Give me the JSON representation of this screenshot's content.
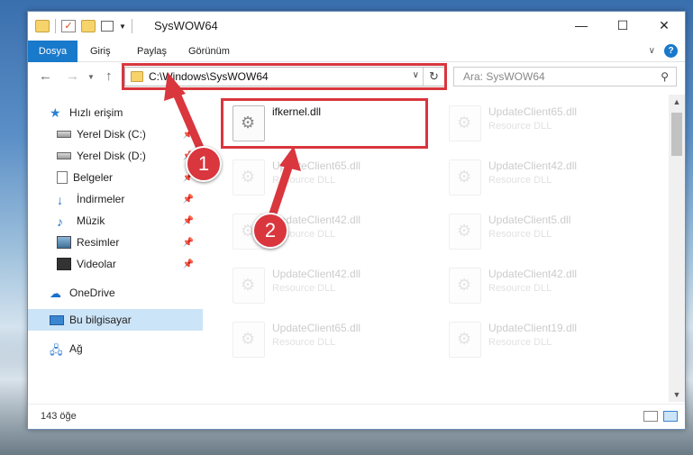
{
  "window": {
    "title": "SysWOW64"
  },
  "ribbon": {
    "tabs": [
      "Dosya",
      "Giriş",
      "Paylaş",
      "Görünüm"
    ],
    "help": "?"
  },
  "nav": {
    "address": "C:\\Windows\\SysWOW64",
    "search_placeholder": "Ara: SysWOW64"
  },
  "sidebar": {
    "items": [
      {
        "label": "Hızlı erişim",
        "icon": "quick-access-star-icon"
      },
      {
        "label": "Yerel Disk (C:)",
        "icon": "disk-icon",
        "pinned": true
      },
      {
        "label": "Yerel Disk (D:)",
        "icon": "disk-icon",
        "pinned": true
      },
      {
        "label": "Belgeler",
        "icon": "documents-icon",
        "pinned": true
      },
      {
        "label": "İndirmeler",
        "icon": "downloads-icon",
        "pinned": true
      },
      {
        "label": "Müzik",
        "icon": "music-icon",
        "pinned": true
      },
      {
        "label": "Resimler",
        "icon": "pictures-icon",
        "pinned": true
      },
      {
        "label": "Videolar",
        "icon": "videos-icon",
        "pinned": true
      },
      {
        "label": "OneDrive",
        "icon": "onedrive-icon"
      },
      {
        "label": "Bu bilgisayar",
        "icon": "this-pc-icon",
        "selected": true
      },
      {
        "label": "Ağ",
        "icon": "network-icon"
      }
    ]
  },
  "files": [
    {
      "name": "ifkernel.dll",
      "sub": ""
    },
    {
      "name": "UpdateClient65.dll",
      "sub": "Resource DLL"
    },
    {
      "name": "UpdateClient65.dll",
      "sub": "Resource DLL"
    },
    {
      "name": "UpdateClient42.dll",
      "sub": "Resource DLL"
    },
    {
      "name": "UpdateClient42.dll",
      "sub": "Resource DLL"
    },
    {
      "name": "UpdateClient5.dll",
      "sub": "Resource DLL"
    },
    {
      "name": "UpdateClient42.dll",
      "sub": "Resource DLL"
    },
    {
      "name": "UpdateClient42.dll",
      "sub": "Resource DLL"
    },
    {
      "name": "UpdateClient65.dll",
      "sub": "Resource DLL"
    },
    {
      "name": "UpdateClient19.dll",
      "sub": "Resource DLL"
    }
  ],
  "status": {
    "count": "143 öğe"
  },
  "annotations": {
    "badge1": "1",
    "badge2": "2",
    "color": "#d9363e"
  }
}
